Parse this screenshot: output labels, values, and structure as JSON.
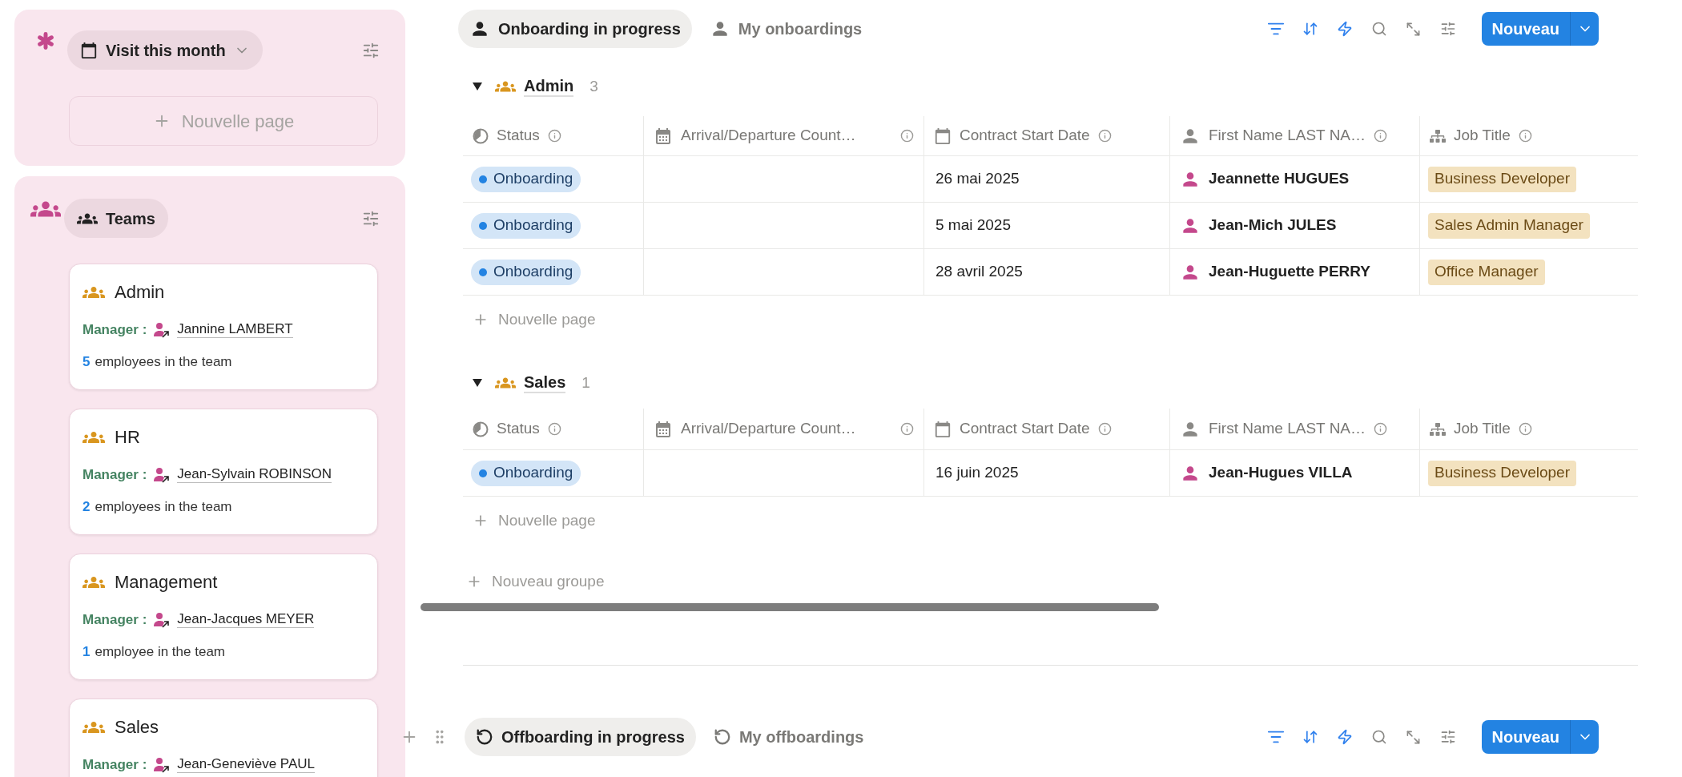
{
  "sidebar": {
    "visit_view": {
      "label": "Visit this month",
      "new_page": "Nouvelle page"
    },
    "teams_view": {
      "label": "Teams",
      "cards": [
        {
          "name": "Admin",
          "manager_label": "Manager :",
          "manager": "Jannine LAMBERT",
          "count": "5",
          "count_text": "employees in the team"
        },
        {
          "name": "HR",
          "manager_label": "Manager :",
          "manager": "Jean-Sylvain ROBINSON",
          "count": "2",
          "count_text": "employees in the team"
        },
        {
          "name": "Management",
          "manager_label": "Manager :",
          "manager": "Jean-Jacques MEYER",
          "count": "1",
          "count_text": "employee in the team"
        },
        {
          "name": "Sales",
          "manager_label": "Manager :",
          "manager": "Jean-Geneviève PAUL"
        }
      ]
    }
  },
  "onboarding": {
    "tabs": [
      {
        "label": "Onboarding in progress",
        "selected": true
      },
      {
        "label": "My onboardings",
        "selected": false
      }
    ],
    "new_button": "Nouveau",
    "groups": [
      {
        "name": "Admin",
        "count": "3",
        "new_page": "Nouvelle page",
        "columns": [
          {
            "label": "Status",
            "kind": "status"
          },
          {
            "label": "Arrival/Departure Count…",
            "kind": "grid-calendar"
          },
          {
            "label": "Contract Start Date",
            "kind": "calendar"
          },
          {
            "label": "First Name LAST NA…",
            "kind": "person"
          },
          {
            "label": "Job Title",
            "kind": "org"
          }
        ],
        "rows": [
          {
            "status": "Onboarding",
            "date": "26 mai 2025",
            "name": "Jeannette HUGUES",
            "job": "Business Developer"
          },
          {
            "status": "Onboarding",
            "date": "5 mai 2025",
            "name": "Jean-Mich JULES",
            "job": "Sales Admin Manager"
          },
          {
            "status": "Onboarding",
            "date": "28 avril 2025",
            "name": "Jean-Huguette PERRY",
            "job": "Office Manager"
          }
        ]
      },
      {
        "name": "Sales",
        "count": "1",
        "new_page": "Nouvelle page",
        "columns": [
          {
            "label": "Status",
            "kind": "status"
          },
          {
            "label": "Arrival/Departure Count…",
            "kind": "grid-calendar"
          },
          {
            "label": "Contract Start Date",
            "kind": "calendar"
          },
          {
            "label": "First Name LAST NA…",
            "kind": "person"
          },
          {
            "label": "Job Title",
            "kind": "org"
          }
        ],
        "rows": [
          {
            "status": "Onboarding",
            "date": "16 juin 2025",
            "name": "Jean-Hugues VILLA",
            "job": "Business Developer"
          }
        ]
      }
    ],
    "new_group": "Nouveau groupe"
  },
  "offboarding": {
    "tabs": [
      {
        "label": "Offboarding in progress",
        "selected": true
      },
      {
        "label": "My offboardings",
        "selected": false
      }
    ],
    "new_button": "Nouveau"
  }
}
